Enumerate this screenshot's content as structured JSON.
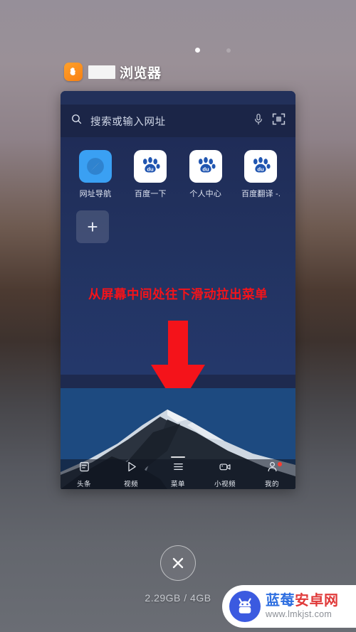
{
  "screen": {
    "indicator_dots": [
      "active",
      "inactive"
    ]
  },
  "task_card": {
    "app_icon": "uc-browser-icon",
    "app_title_redacted": true,
    "app_title": "浏览器",
    "search": {
      "placeholder": "搜索或输入网址",
      "search_icon": "search-icon",
      "mic_icon": "microphone-icon",
      "scan_icon": "qr-scan-icon"
    },
    "shortcuts": [
      {
        "label": "网址导航",
        "icon": "compass-icon"
      },
      {
        "label": "百度一下",
        "icon": "baidu-paw-icon"
      },
      {
        "label": "个人中心",
        "icon": "baidu-paw-icon"
      },
      {
        "label": "百度翻译 -...",
        "icon": "baidu-paw-icon"
      }
    ],
    "add_shortcut": {
      "label": "+",
      "icon": "plus-icon"
    },
    "hint": "从屏幕中间处往下滑动拉出菜单",
    "arrow": "down-arrow-icon",
    "arrow_color": "#f4131a",
    "bottom_nav": [
      {
        "label": "头条",
        "icon": "headlines-icon",
        "badge": false
      },
      {
        "label": "视频",
        "icon": "play-icon",
        "badge": false
      },
      {
        "label": "菜单",
        "icon": "menu-icon",
        "badge": false
      },
      {
        "label": "小视频",
        "icon": "video-camera-icon",
        "badge": false
      },
      {
        "label": "我的",
        "icon": "person-icon",
        "badge": true
      }
    ]
  },
  "close_button": {
    "icon": "close-icon",
    "label": "×"
  },
  "memory": {
    "text": "2.29GB / 4GB",
    "used": "2.29GB",
    "total": "4GB"
  },
  "watermark": {
    "logo_icon": "android-robot-icon",
    "title_blue": "蓝莓",
    "title_red": "安卓网",
    "url": "www.lmkjst.com"
  },
  "colors": {
    "accent_red": "#f4131a",
    "card_navy": "#22305a",
    "uc_orange": "#f98012",
    "badge_red": "#ff3b30",
    "watermark_blue": "#2f6fe0",
    "watermark_red": "#e03a3a"
  }
}
